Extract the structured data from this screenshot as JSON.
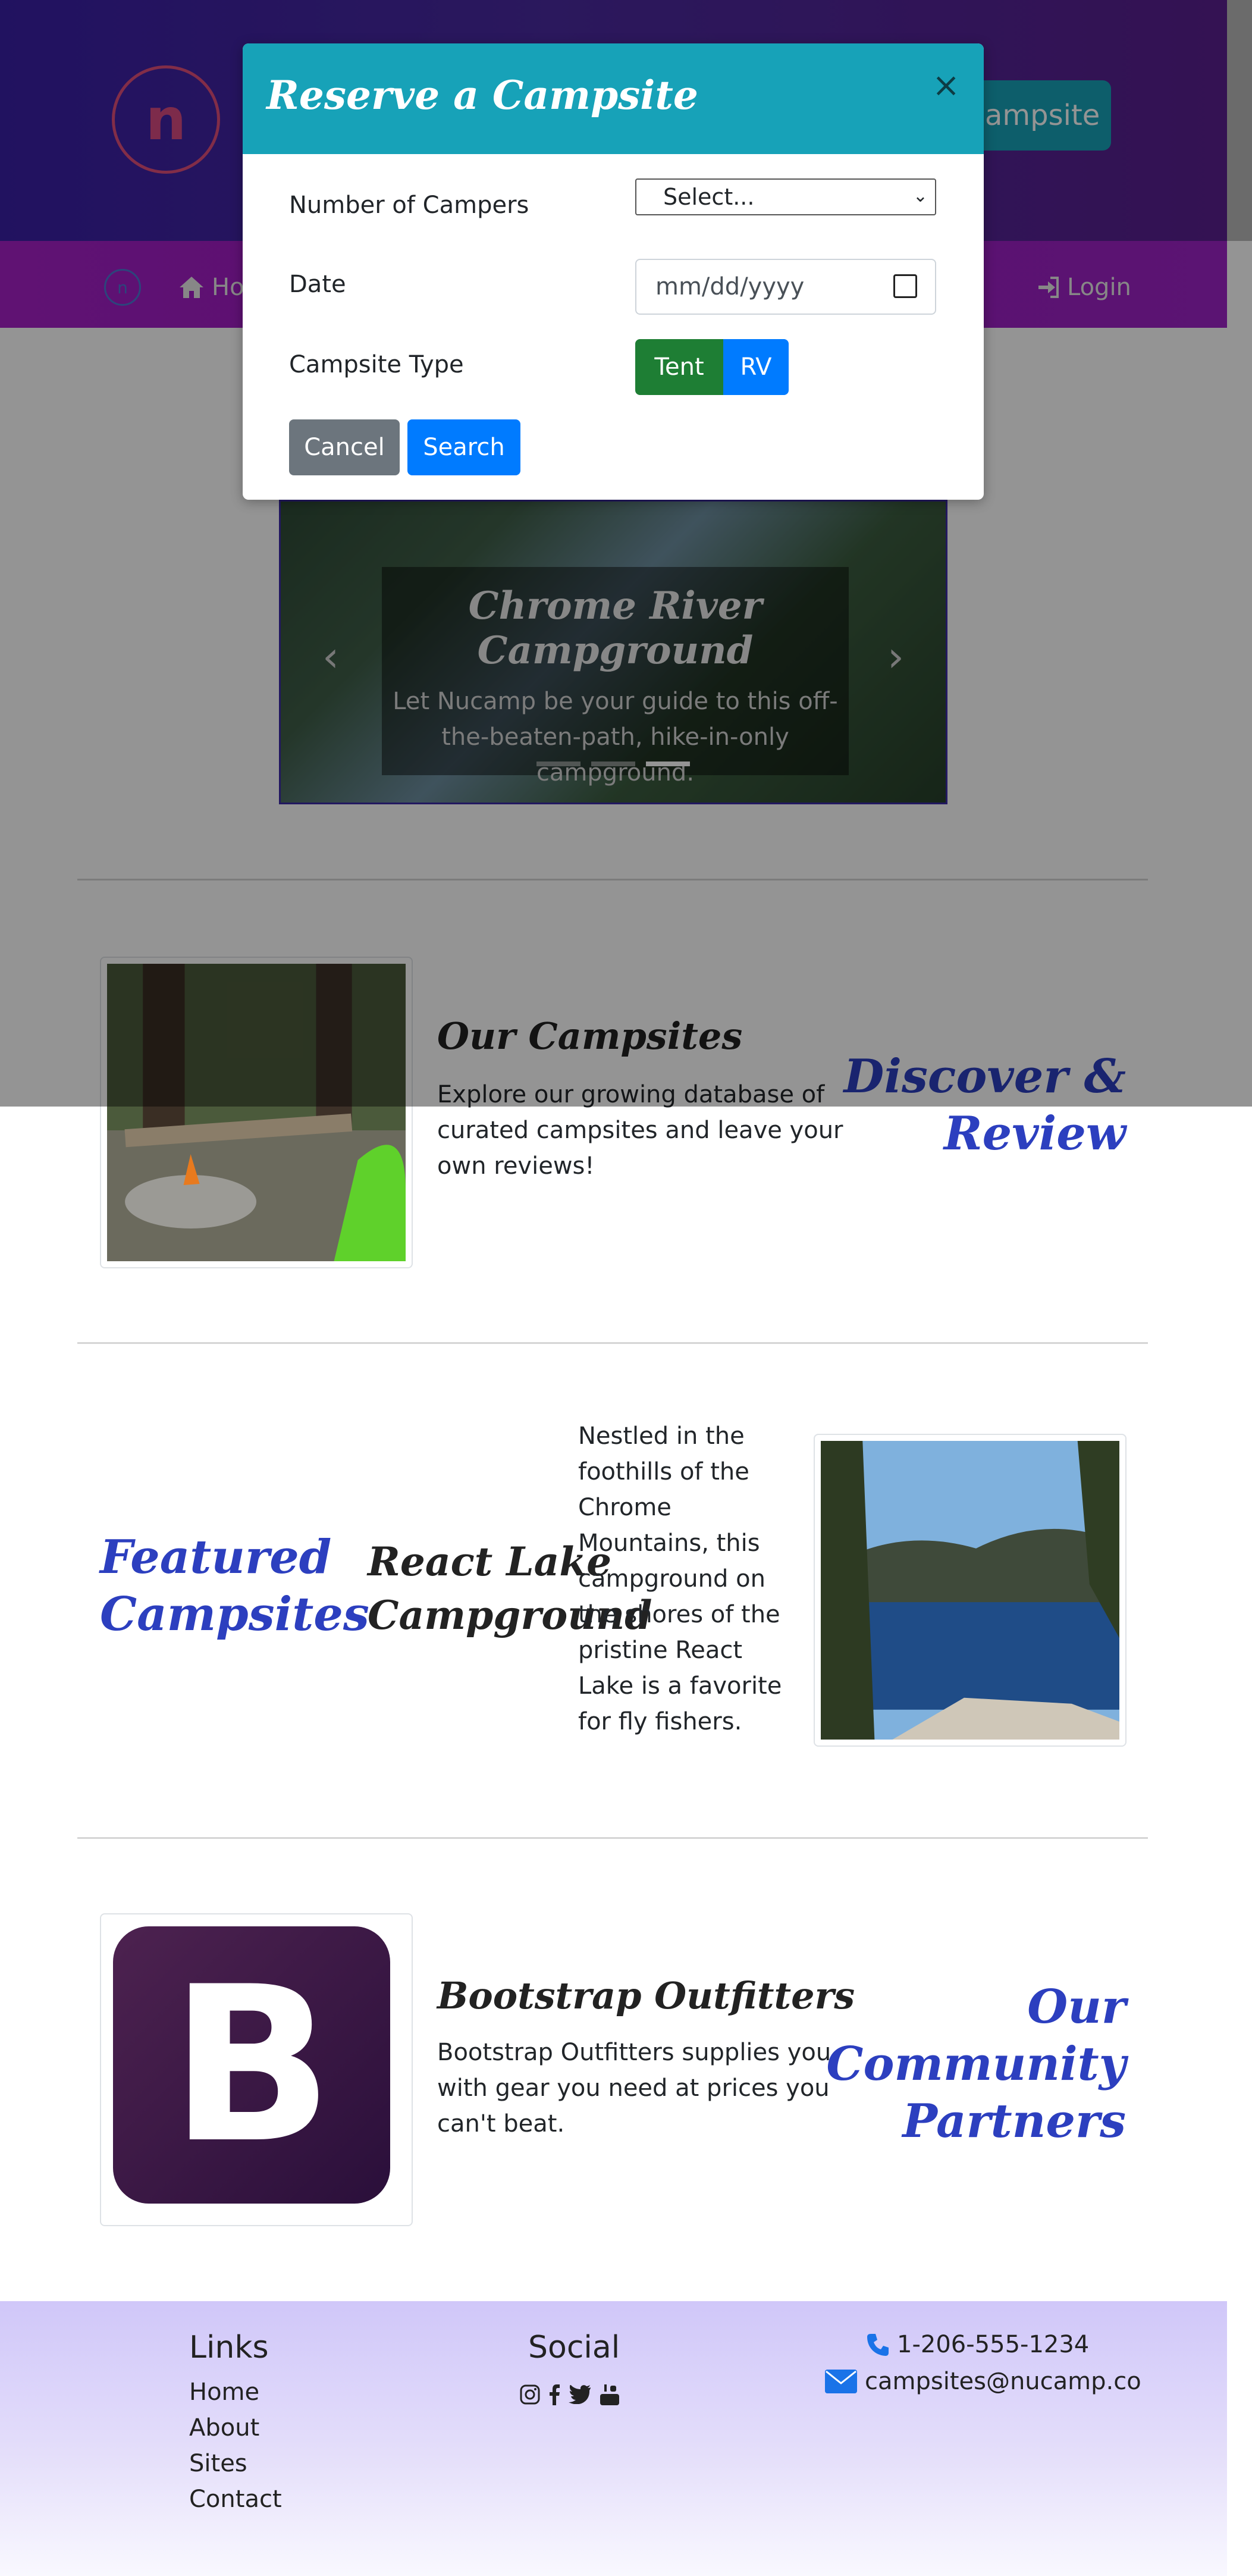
{
  "header": {
    "logo": "n",
    "cta_partial": "ampsite"
  },
  "nav": {
    "home_partial": "Ho",
    "login": "Login"
  },
  "carousel": {
    "title": "Chrome River Campground",
    "text": "Let Nucamp be your guide to this off-the-beaten-path, hike-in-only campground.",
    "indicator_count": 3,
    "active_indicator": 3
  },
  "section_campsites": {
    "title": "Our Campsites",
    "text": "Explore our growing database of curated campsites and leave your own reviews!",
    "side_title_line1": "Discover &",
    "side_title_line2": "Review"
  },
  "section_featured": {
    "side_title_line1": "Featured",
    "side_title_line2": "Campsites",
    "title_line1": "React Lake",
    "title_line2": "Campground",
    "text": "Nestled in the foothills of the Chrome Mountains, this campground on the shores of the pristine React Lake is a favorite for fly fishers."
  },
  "section_partners": {
    "logo_letter": "B",
    "title": "Bootstrap Outfitters",
    "text": "Bootstrap Outfitters supplies you with gear you need at prices you can't beat.",
    "side_title_line1": "Our",
    "side_title_line2": "Community",
    "side_title_line3": "Partners"
  },
  "modal": {
    "title": "Reserve a Campsite",
    "close": "×",
    "campers_label": "Number of Campers",
    "campers_value": "Select...",
    "date_label": "Date",
    "date_placeholder": "mm/dd/yyyy",
    "type_label": "Campsite Type",
    "type_tent": "Tent",
    "type_rv": "RV",
    "cancel": "Cancel",
    "search": "Search"
  },
  "footer": {
    "links_title": "Links",
    "links": [
      "Home",
      "About",
      "Sites",
      "Contact"
    ],
    "social_title": "Social",
    "social_icons": [
      "instagram-icon",
      "facebook-icon",
      "twitter-icon",
      "youtube-icon"
    ],
    "phone": "1-206-555-1234",
    "email": "campsites@nucamp.co"
  },
  "colors": {
    "modal_header": "#17a2b8",
    "tent_button": "#1e7e34",
    "rv_button": "#007bff",
    "cancel_button": "#6c757d",
    "search_button": "#007bff",
    "accent_blue_heading": "#2c3fbf"
  }
}
